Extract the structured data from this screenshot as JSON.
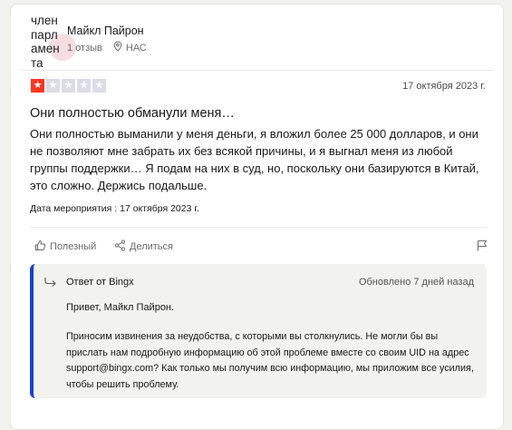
{
  "reviewer": {
    "avatar_text": [
      "член",
      "парл",
      "амен",
      "та"
    ],
    "name": "Майкл Пайрон",
    "review_count": "1 отзыв",
    "country": "НАС"
  },
  "review": {
    "rating": 1,
    "rating_max": 5,
    "date": "17 октября 2023 г.",
    "title": "Они полностью обманули меня…",
    "body": "Они полностью выманили у меня деньги, я вложил более 25 000 долларов, и они не позволяют мне забрать их без всякой причины, и я выгнал меня из любой группы поддержки… Я подам на них в суд, но, поскольку они базируются в Китай, это сложно. Держись подальше.",
    "experience_label": "Дата мероприятия :",
    "experience_date": "17 октября 2023 г."
  },
  "actions": {
    "helpful": "Полезный",
    "share": "Делиться"
  },
  "reply": {
    "from": "Ответ от Bingx",
    "updated": "Обновлено 7 дней назад",
    "greeting": "Привет, Майкл Пайрон.",
    "body": "Приносим извинения за неудобства, с которыми вы столкнулись. Не могли бы вы прислать нам подробную информацию об этой проблеме вместе со своим UID на адрес support@bingx.com? Как только мы получим всю информацию, мы приложим все усилия, чтобы решить проблему."
  },
  "colors": {
    "star_active": "#ff3722",
    "star_inactive": "#dcdce6",
    "reply_accent": "#1c3fcf",
    "reply_bg": "#f2f2ee"
  }
}
